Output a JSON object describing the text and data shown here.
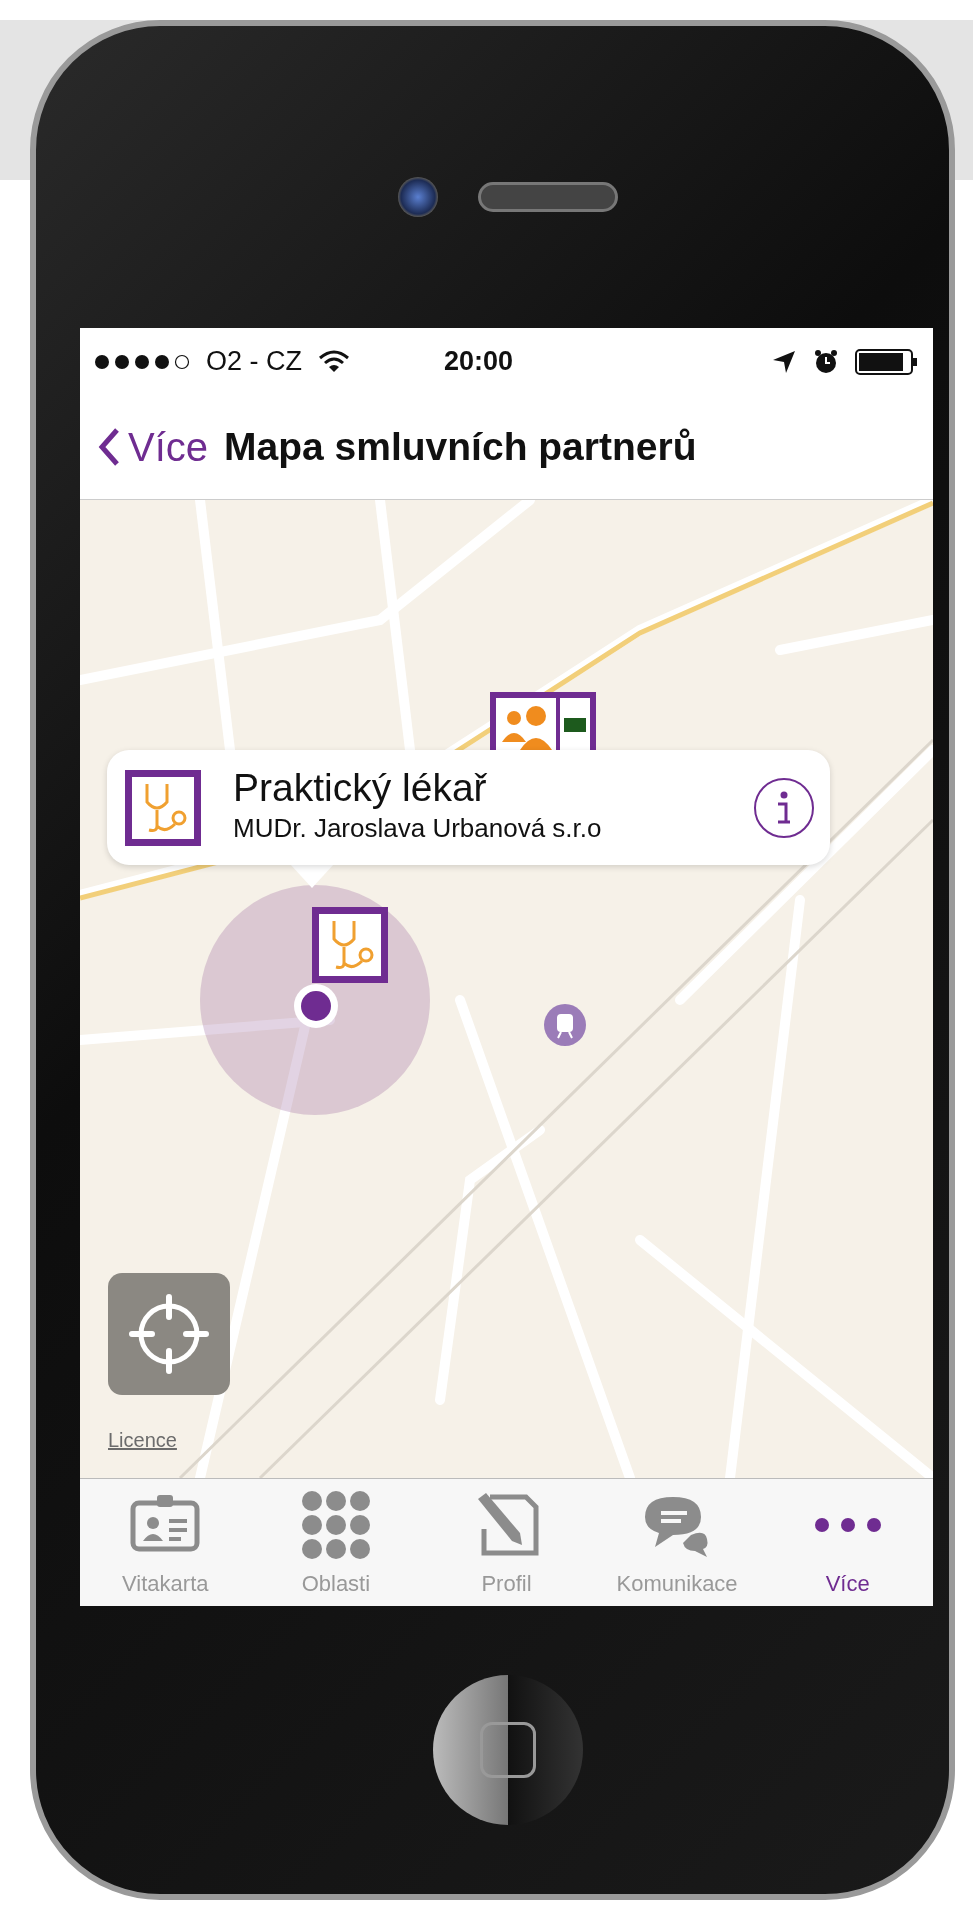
{
  "status_bar": {
    "carrier": "O2 - CZ",
    "time": "20:00"
  },
  "nav_bar": {
    "back": "Více",
    "title": "Mapa smluvních partnerů"
  },
  "callout": {
    "title": "Praktický lékař",
    "subtitle": "MUDr. Jaroslava Urbanová s.r.o"
  },
  "map": {
    "licence": "Licence"
  },
  "tabs": [
    {
      "label": "Vitakarta",
      "kind": "card",
      "selected": false
    },
    {
      "label": "Oblasti",
      "kind": "grid",
      "selected": false
    },
    {
      "label": "Profil",
      "kind": "edit",
      "selected": false
    },
    {
      "label": "Komunikace",
      "kind": "chat",
      "selected": false
    },
    {
      "label": "Více",
      "kind": "more",
      "selected": true
    }
  ]
}
